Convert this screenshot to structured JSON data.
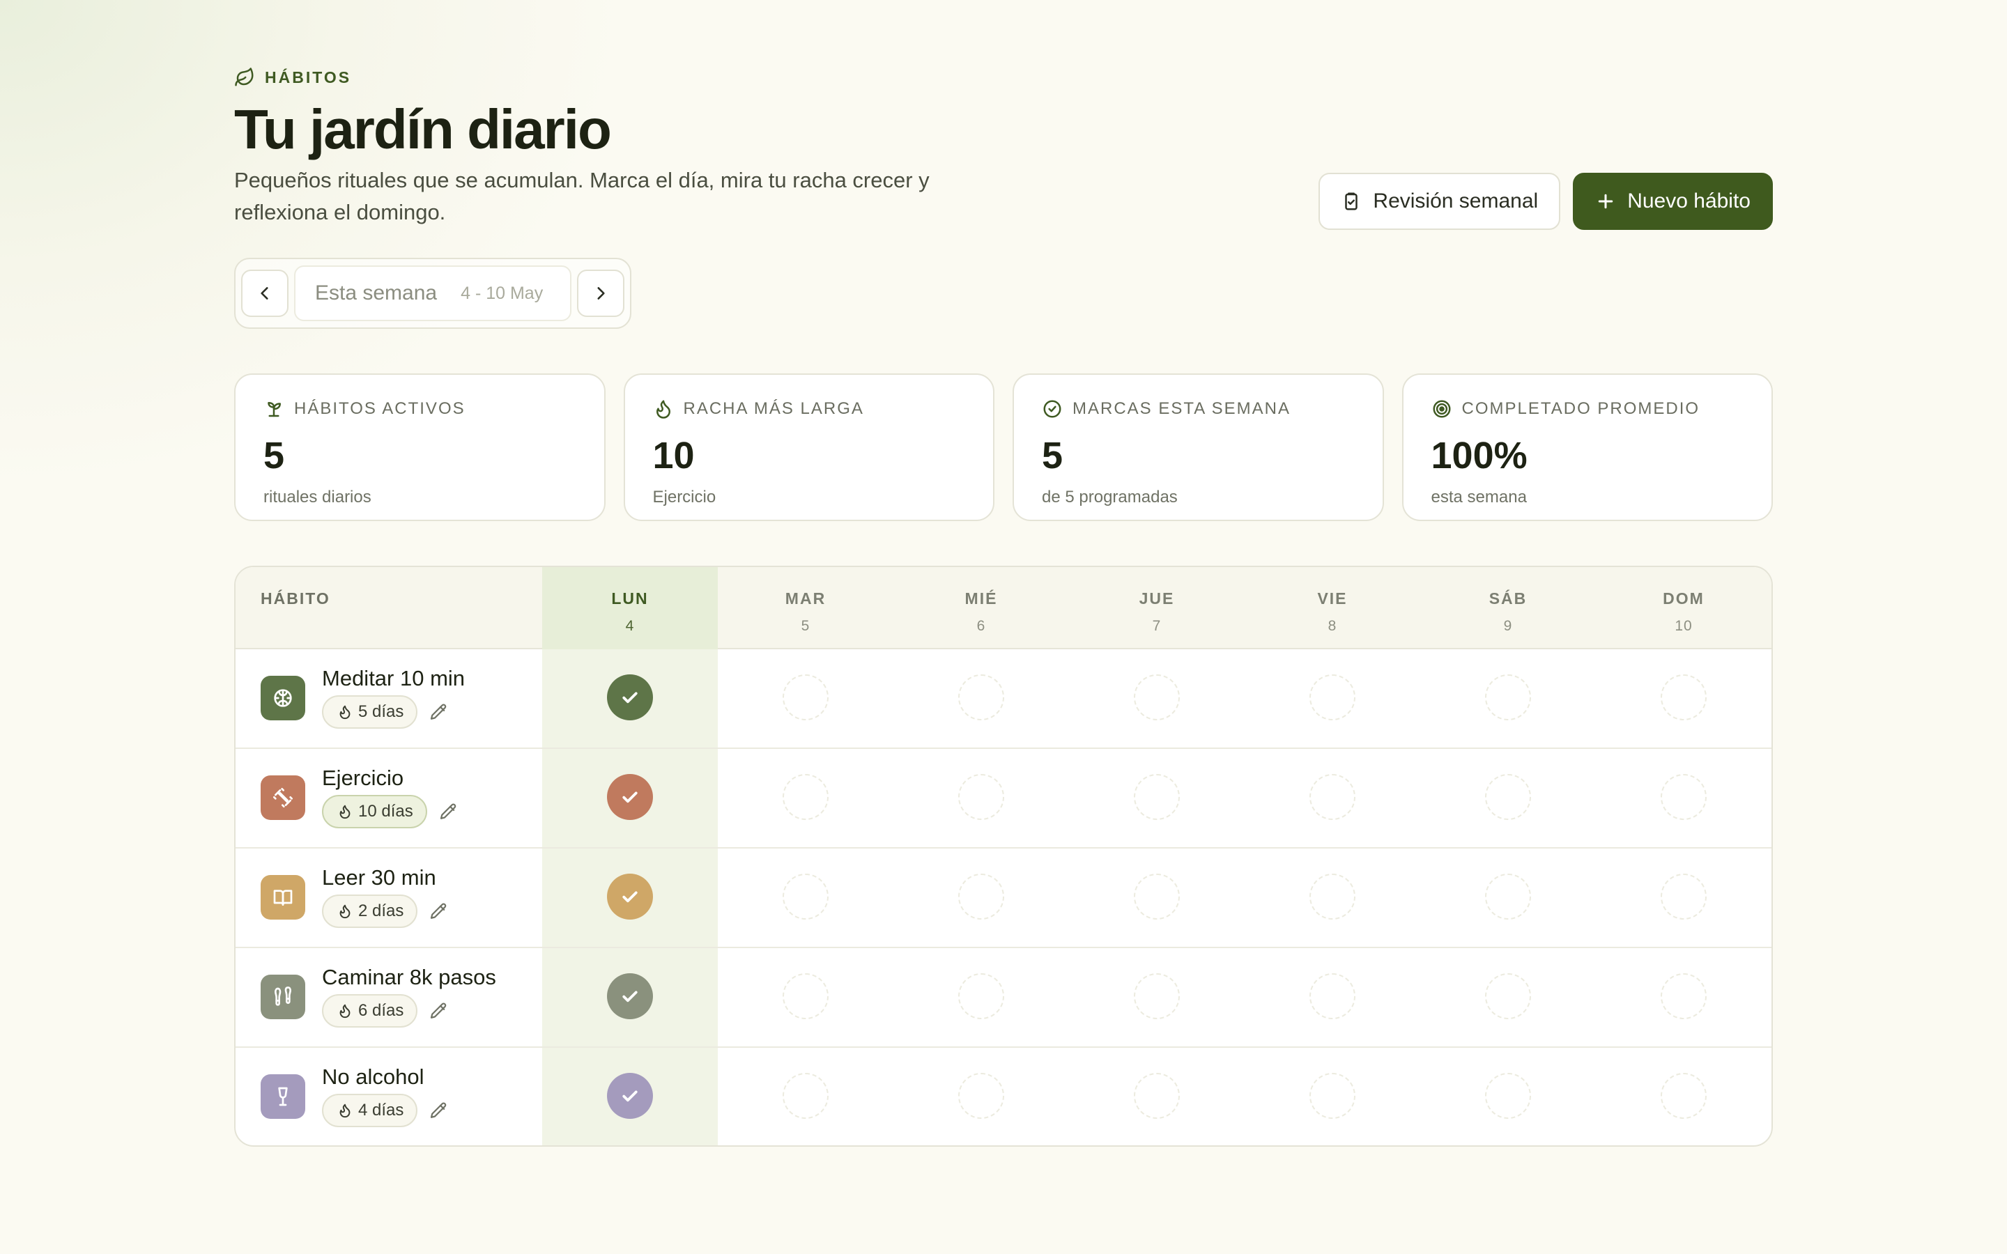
{
  "header": {
    "eyebrow": "HÁBITOS",
    "title": "Tu jardín diario",
    "subtitle": "Pequeños rituales que se acumulan. Marca el día, mira tu racha crecer y reflexiona el domingo.",
    "review_button": "Revisión semanal",
    "new_button": "Nuevo hábito"
  },
  "week_nav": {
    "label": "Esta semana",
    "range": "4 - 10 May"
  },
  "stats": [
    {
      "label": "HÁBITOS ACTIVOS",
      "value": "5",
      "sub": "rituales diarios",
      "icon": "sprout-icon"
    },
    {
      "label": "RACHA MÁS LARGA",
      "value": "10",
      "sub": "Ejercicio",
      "icon": "flame-icon"
    },
    {
      "label": "MARCAS ESTA SEMANA",
      "value": "5",
      "sub": "de 5 programadas",
      "icon": "check-circle-icon"
    },
    {
      "label": "COMPLETADO PROMEDIO",
      "value": "100%",
      "sub": "esta semana",
      "icon": "target-icon"
    }
  ],
  "table": {
    "habit_header": "HÁBITO",
    "days": [
      {
        "name": "LUN",
        "num": "4",
        "today": true
      },
      {
        "name": "MAR",
        "num": "5"
      },
      {
        "name": "MIÉ",
        "num": "6"
      },
      {
        "name": "JUE",
        "num": "7"
      },
      {
        "name": "VIE",
        "num": "8"
      },
      {
        "name": "SÁB",
        "num": "9"
      },
      {
        "name": "DOM",
        "num": "10"
      }
    ],
    "habits": [
      {
        "name": "Meditar 10 min",
        "streak": "5 días",
        "color": "#5e7548",
        "icon": "brain-icon",
        "done": [
          true,
          false,
          false,
          false,
          false,
          false,
          false
        ]
      },
      {
        "name": "Ejercicio",
        "streak": "10 días",
        "color": "#c07a5e",
        "icon": "dumbbell-icon",
        "hot": true,
        "done": [
          true,
          false,
          false,
          false,
          false,
          false,
          false
        ]
      },
      {
        "name": "Leer 30 min",
        "streak": "2 días",
        "color": "#cfa767",
        "icon": "book-icon",
        "done": [
          true,
          false,
          false,
          false,
          false,
          false,
          false
        ]
      },
      {
        "name": "Caminar 8k pasos",
        "streak": "6 días",
        "color": "#8a917d",
        "icon": "footprints-icon",
        "done": [
          true,
          false,
          false,
          false,
          false,
          false,
          false
        ]
      },
      {
        "name": "No alcohol",
        "streak": "4 días",
        "color": "#a49bbd",
        "icon": "glass-icon",
        "done": [
          true,
          false,
          false,
          false,
          false,
          false,
          false
        ]
      }
    ]
  }
}
